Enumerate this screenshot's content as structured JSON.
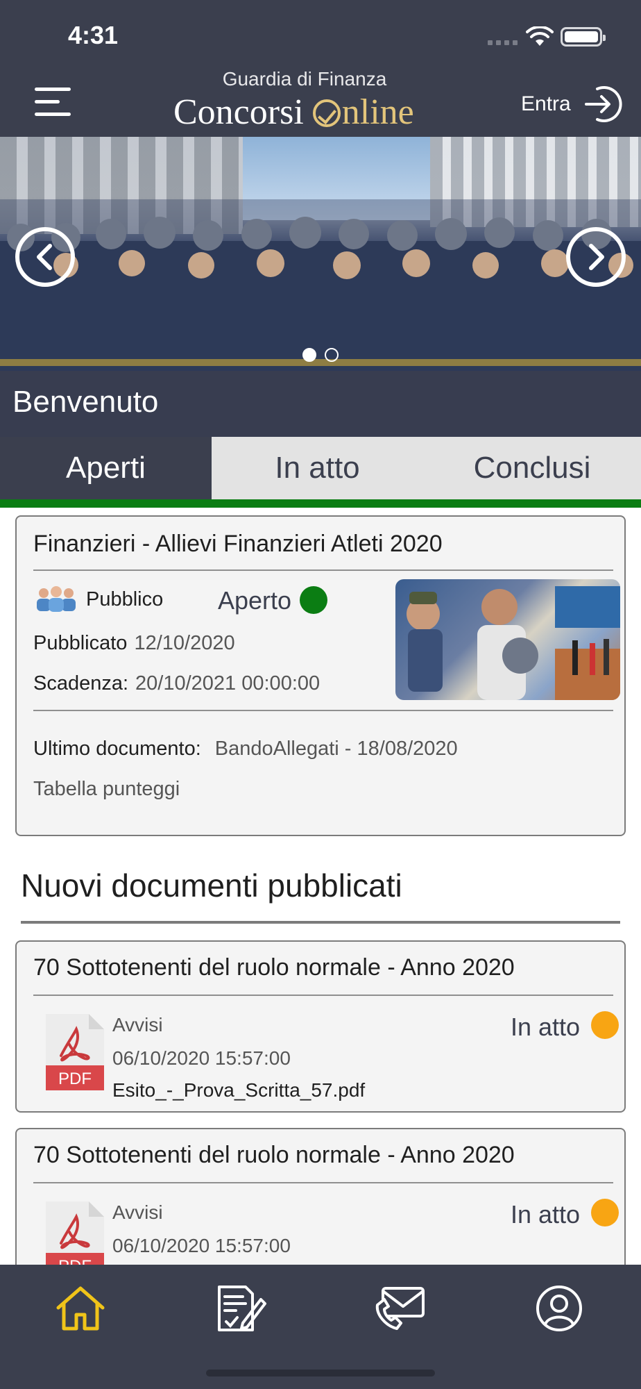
{
  "status_bar": {
    "time": "4:31"
  },
  "header": {
    "brand_sub": "Guardia di Finanza",
    "brand_title_prefix": "Concorsi",
    "brand_title_suffix": "nline",
    "login_label": "Entra"
  },
  "banner": {
    "welcome": "Benvenuto",
    "slide_count": 2,
    "active_slide": 0
  },
  "tabs": [
    {
      "label": "Aperti",
      "active": true
    },
    {
      "label": "In atto",
      "active": false
    },
    {
      "label": "Conclusi",
      "active": false
    }
  ],
  "active_tab_color": "#3b3f4e",
  "tab_underline_color": "#0b7d13",
  "concorso": {
    "title": "Finanzieri - Allievi Finanzieri Atleti 2020",
    "audience": "Pubblico",
    "status": "Aperto",
    "status_color": "#0b7d13",
    "published_label": "Pubblicato",
    "published_value": "12/10/2020",
    "deadline_label": "Scadenza:",
    "deadline_value": "20/10/2021 00:00:00",
    "last_doc_label": "Ultimo documento:",
    "last_doc_value": "BandoAllegati - 18/08/2020",
    "extra_link": "Tabella punteggi"
  },
  "new_docs": {
    "heading": "Nuovi documenti pubblicati",
    "items": [
      {
        "title": "70 Sottotenenti del ruolo normale - Anno 2020",
        "category": "Avvisi",
        "date": "06/10/2020 15:57:00",
        "file": "Esito_-_Prova_Scritta_57.pdf",
        "status": "In atto",
        "status_color": "#f8a513",
        "icon_label": "PDF"
      },
      {
        "title": "70 Sottotenenti del ruolo normale - Anno 2020",
        "category": "Avvisi",
        "date": "06/10/2020 15:57:00",
        "status": "In atto",
        "status_color": "#f8a513",
        "icon_label": "PDF"
      }
    ]
  },
  "bottom_nav": [
    {
      "icon": "home-icon",
      "active": true
    },
    {
      "icon": "document-sign-icon",
      "active": false
    },
    {
      "icon": "mail-phone-icon",
      "active": false
    },
    {
      "icon": "user-icon",
      "active": false
    }
  ]
}
